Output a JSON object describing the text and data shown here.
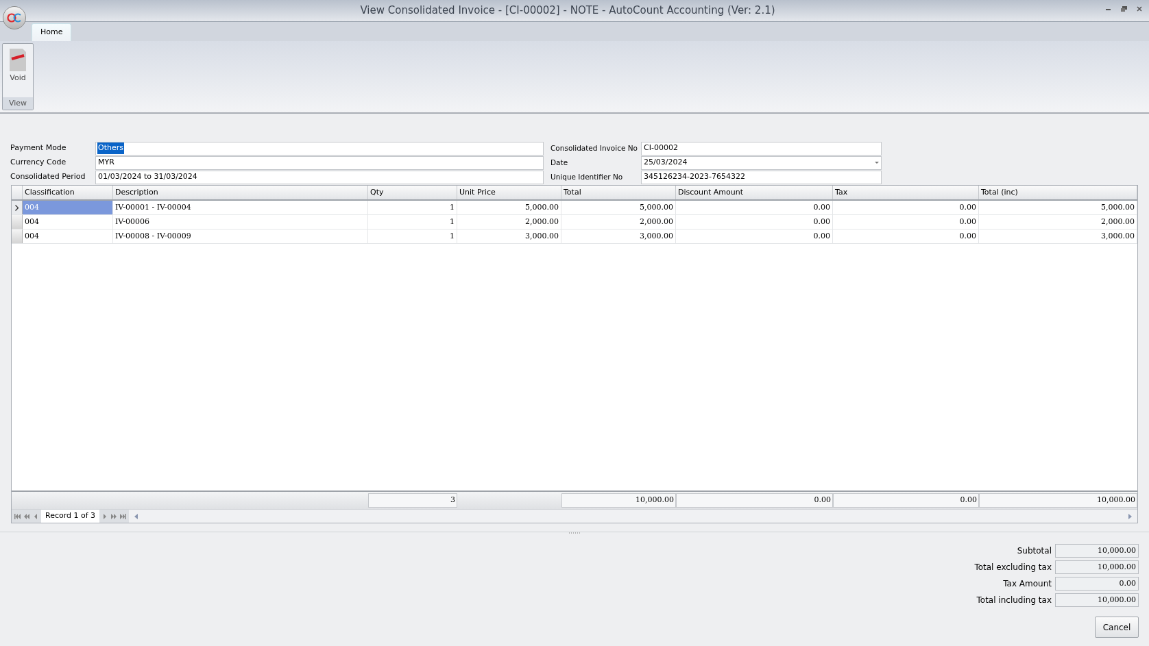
{
  "window": {
    "title": "View Consolidated Invoice - [CI-00002] - NOTE - AutoCount Accounting (Ver: 2.1)"
  },
  "tabs": [
    {
      "label": "Home",
      "selected": true
    }
  ],
  "ribbon": {
    "group": "View",
    "buttons": [
      {
        "label": "Void"
      }
    ]
  },
  "form_left": [
    {
      "label": "Payment Mode",
      "value": "Others",
      "selected": true
    },
    {
      "label": "Currency Code",
      "value": "MYR",
      "selected": false
    },
    {
      "label": "Consolidated Period",
      "value": "01/03/2024 to 31/03/2024",
      "selected": false
    }
  ],
  "form_right": [
    {
      "label": "Consolidated Invoice No",
      "value": "CI-00002",
      "kind": "text"
    },
    {
      "label": "Date",
      "value": "25/03/2024",
      "kind": "dropdown"
    },
    {
      "label": "Unique Identifier No",
      "value": "345126234-2023-7654322",
      "kind": "text"
    }
  ],
  "table": {
    "columns": [
      {
        "label": "Classification"
      },
      {
        "label": "Description"
      },
      {
        "label": "Qty"
      },
      {
        "label": "Unit Price"
      },
      {
        "label": "Total"
      },
      {
        "label": "Discount Amount"
      },
      {
        "label": "Tax"
      },
      {
        "label": "Total (inc)"
      }
    ],
    "rows": [
      {
        "selected": true,
        "cells": [
          "004",
          "IV-00001 - IV-00004",
          "1",
          "5,000.00",
          "5,000.00",
          "0.00",
          "0.00",
          "5,000.00"
        ]
      },
      {
        "selected": false,
        "cells": [
          "004",
          "IV-00006",
          "1",
          "2,000.00",
          "2,000.00",
          "0.00",
          "0.00",
          "2,000.00"
        ]
      },
      {
        "selected": false,
        "cells": [
          "004",
          "IV-00008 - IV-00009",
          "1",
          "3,000.00",
          "3,000.00",
          "0.00",
          "0.00",
          "3,000.00"
        ]
      }
    ],
    "footer": {
      "qty": "3",
      "total": "10,000.00",
      "discount_amount": "0.00",
      "tax": "0.00",
      "total_inc": "10,000.00"
    },
    "navigator": "Record 1 of 3"
  },
  "totals": [
    {
      "label": "Subtotal",
      "value": "10,000.00"
    },
    {
      "label": "Total excluding tax",
      "value": "10,000.00"
    },
    {
      "label": "Tax Amount",
      "value": "0.00"
    },
    {
      "label": "Total including tax",
      "value": "10,000.00"
    }
  ],
  "buttons": [
    "Cancel"
  ]
}
